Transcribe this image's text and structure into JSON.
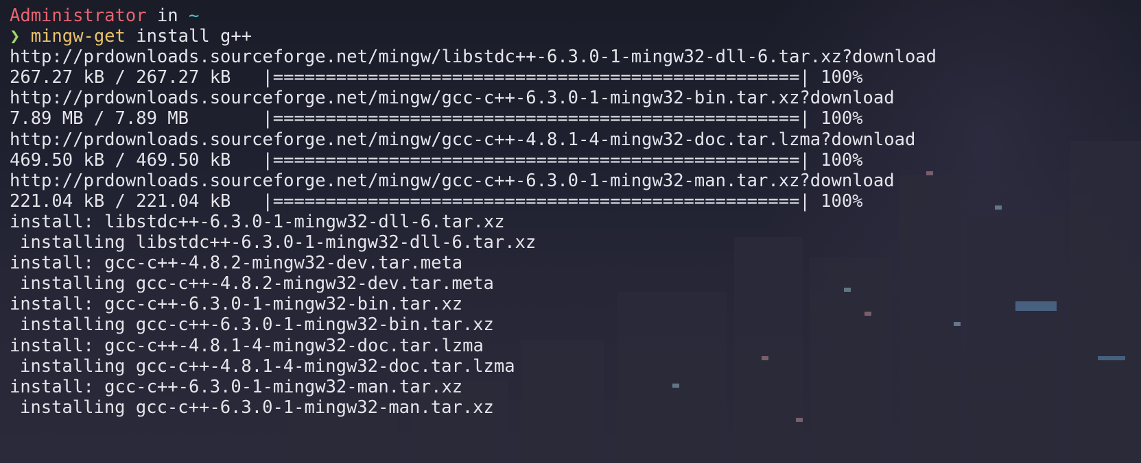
{
  "prompt": {
    "user": "Administrator",
    "in_word": "in",
    "dir": "~",
    "chevron": "❯",
    "command": "mingw-get",
    "args": " install g++"
  },
  "output_lines": [
    "http://prdownloads.sourceforge.net/mingw/libstdc++-6.3.0-1-mingw32-dll-6.tar.xz?download",
    "267.27 kB / 267.27 kB   |==================================================| 100%",
    "http://prdownloads.sourceforge.net/mingw/gcc-c++-6.3.0-1-mingw32-bin.tar.xz?download",
    "7.89 MB / 7.89 MB       |==================================================| 100%",
    "http://prdownloads.sourceforge.net/mingw/gcc-c++-4.8.1-4-mingw32-doc.tar.lzma?download",
    "469.50 kB / 469.50 kB   |==================================================| 100%",
    "http://prdownloads.sourceforge.net/mingw/gcc-c++-6.3.0-1-mingw32-man.tar.xz?download",
    "221.04 kB / 221.04 kB   |==================================================| 100%",
    "install: libstdc++-6.3.0-1-mingw32-dll-6.tar.xz",
    "installing libstdc++-6.3.0-1-mingw32-dll-6.tar.xz",
    "install: gcc-c++-4.8.2-mingw32-dev.tar.meta",
    "installing gcc-c++-4.8.2-mingw32-dev.tar.meta",
    "install: gcc-c++-6.3.0-1-mingw32-bin.tar.xz",
    "installing gcc-c++-6.3.0-1-mingw32-bin.tar.xz",
    "install: gcc-c++-4.8.1-4-mingw32-doc.tar.lzma",
    "installing gcc-c++-4.8.1-4-mingw32-doc.tar.lzma",
    "install: gcc-c++-6.3.0-1-mingw32-man.tar.xz",
    "installing gcc-c++-6.3.0-1-mingw32-man.tar.xz"
  ],
  "colors": {
    "user": "#e96470",
    "dir": "#4fc1c6",
    "chevron": "#9fd46a",
    "command": "#e8c36b",
    "text": "#e4e4ea",
    "background": "#1c1e2b"
  }
}
